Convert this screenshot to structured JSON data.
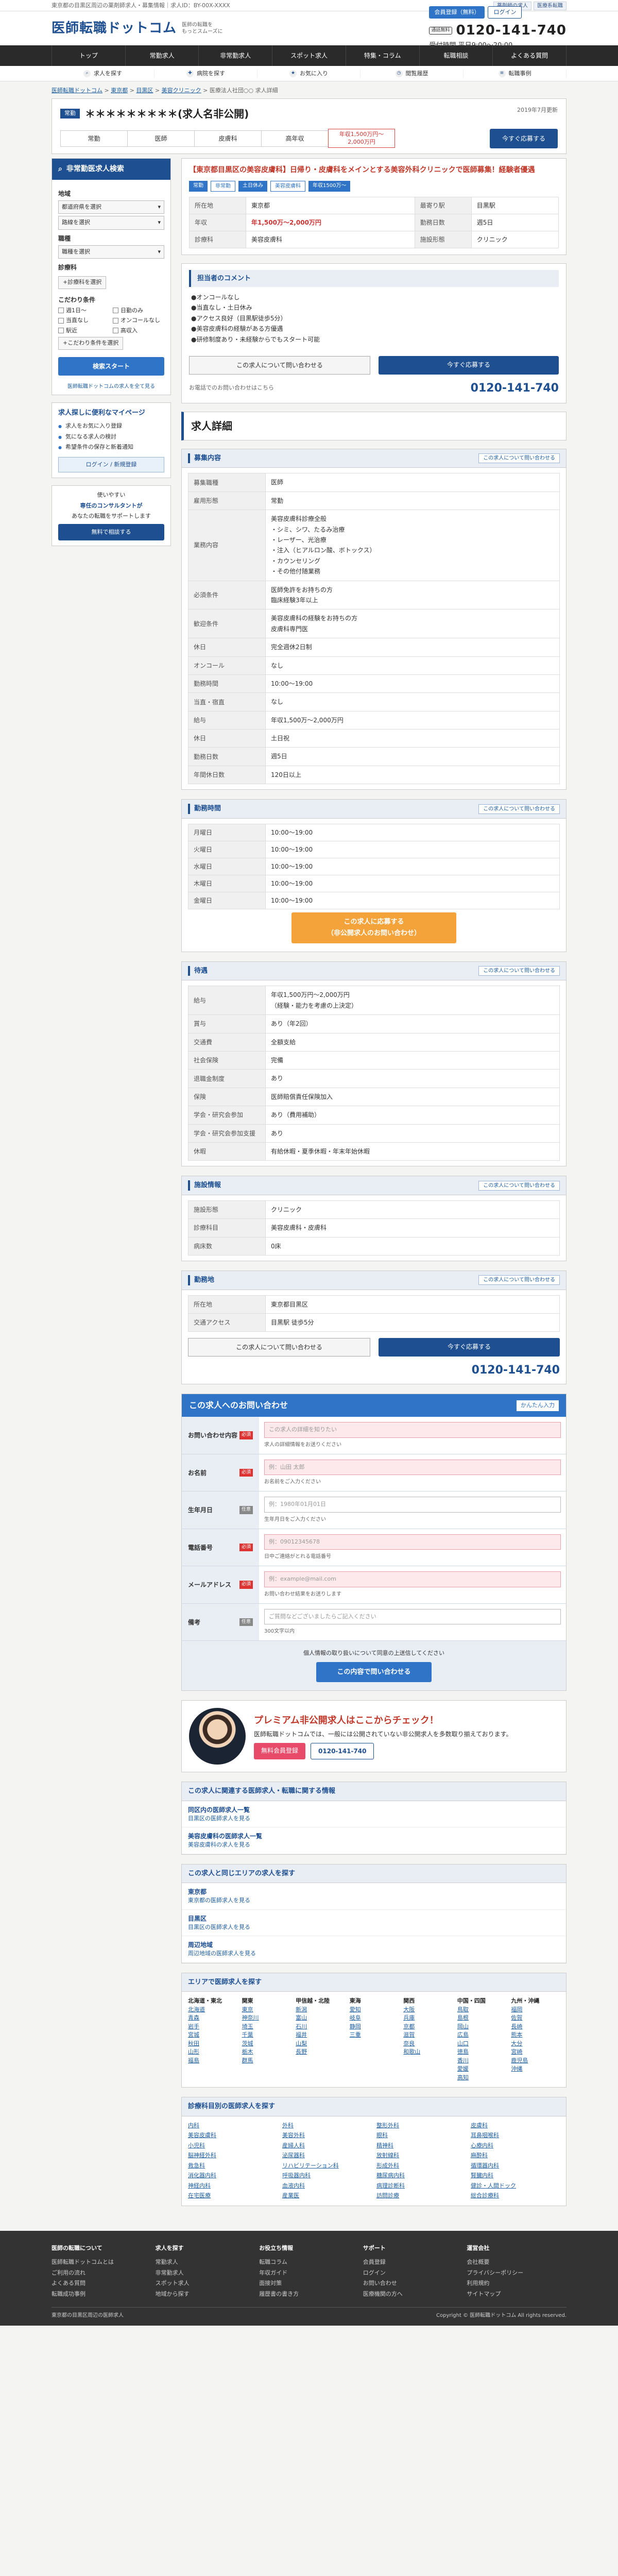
{
  "topbar": {
    "text": "東京都の目黒区周辺の薬剤師求人・募集情報｜求人ID：BY-00X-XXXX",
    "links": [
      "薬剤師の求人",
      "医療系転職"
    ]
  },
  "header": {
    "logo": "医師転職ドットコム",
    "sub_line1": "医師の転職を",
    "sub_line2": "もっとスムーズに",
    "register": "会員登録（無料）",
    "login": "ログイン",
    "tel_free": "通話無料",
    "tel": "0120-141-740",
    "hours": "受付時間 平日9:00〜20:00"
  },
  "nav": [
    "トップ",
    "常勤求人",
    "非常勤求人",
    "スポット求人",
    "特集・コラム",
    "転職相談",
    "よくある質問"
  ],
  "subnav": [
    "求人を探す",
    "病院を探す",
    "お気に入り",
    "閲覧履歴",
    "転職事例"
  ],
  "crumbs": [
    "医師転職ドットコム",
    "東京都",
    "目黒区",
    "美容クリニック",
    "医療法人社団○○ 求人詳細"
  ],
  "title": {
    "tag": "常勤",
    "name": "＊＊＊＊＊＊＊＊＊(求人名非公開)",
    "date": "2019年7月更新",
    "cells": [
      "常勤",
      "医師",
      "皮膚科",
      "高年収"
    ],
    "highlight": "年収1,500万円〜\n2,000万円",
    "cta": "今すぐ応募する"
  },
  "side": {
    "head": "非常勤医求人検索",
    "area_label": "地域",
    "area_sel": "都道府県を選択",
    "line_sel": "路線を選択",
    "job_label": "職種",
    "job_sel": "職種を選択",
    "spec_label": "診療科",
    "spec_sel": "+診療科を選択",
    "cond_label": "こだわり条件",
    "conds": [
      "週1日〜",
      "日勤のみ",
      "当直なし",
      "オンコールなし",
      "駅近",
      "高収入"
    ],
    "more": "+こだわり条件を選択",
    "search": "検索スタート",
    "foot": "医師転職ドットコムの求人を全て見る",
    "reg_title": "求人探しに便利なマイページ",
    "reg_items": [
      "求人をお気に入り登録",
      "気になる求人の検討",
      "希望条件の保存と新着通知"
    ],
    "reg_btn": "ログイン / 新規登録",
    "ban_1": "使いやすい",
    "ban_2": "専任のコンサルタントが",
    "ban_3": "あなたの転職をサポートします",
    "ban_btn": "無料で相談する"
  },
  "card": {
    "lead": "【東京都目黒区の美容皮膚科】日帰り・皮膚科をメインとする美容外科クリニックで医師募集！経験者優遇",
    "tags": [
      "常勤",
      "非常勤",
      "土日休み",
      "美容皮膚科",
      "年収1500万〜"
    ],
    "rows": [
      [
        "所在地",
        "東京都",
        "最寄り駅",
        "目黒駅"
      ],
      [
        "年収",
        "年1,500万〜2,000万円",
        "勤務日数",
        "週5日"
      ],
      [
        "診療科",
        "美容皮膚科",
        "施設形態",
        "クリニック"
      ]
    ]
  },
  "features": {
    "head": "担当者のコメント",
    "text": "●オンコールなし\n●当直なし・土日休み\n●アクセス良好（目黒駅徒歩5分）\n●美容皮膚科の経験がある方優遇\n●研修制度あり・未経験からでもスタート可能",
    "cta1": "この求人について問い合わせる",
    "cta2": "今すぐ応募する",
    "tel_lbl": "お電話でのお問い合わせはこちら",
    "tel": "0120-141-740"
  },
  "detail_head": "求人詳細",
  "d1": {
    "head": "募集内容",
    "more": "この求人について問い合わせる",
    "rows": [
      [
        "募集職種",
        "医師"
      ],
      [
        "雇用形態",
        "常勤"
      ],
      [
        "業務内容",
        "美容皮膚科診療全般\n・シミ、シワ、たるみ治療\n・レーザー、光治療\n・注入（ヒアルロン酸、ボトックス）\n・カウンセリング\n・その他付随業務"
      ],
      [
        "必須条件",
        "医師免許をお持ちの方\n臨床経験3年以上"
      ],
      [
        "歓迎条件",
        "美容皮膚科の経験をお持ちの方\n皮膚科専門医"
      ],
      [
        "休日",
        "完全週休2日制"
      ],
      [
        "オンコール",
        "なし"
      ],
      [
        "勤務時間",
        "10:00〜19:00"
      ],
      [
        "当直・宿直",
        "なし"
      ],
      [
        "給与",
        "年収1,500万〜2,000万円"
      ],
      [
        "休日",
        "土日祝"
      ],
      [
        "勤務日数",
        "週5日"
      ],
      [
        "年間休日数",
        "120日以上"
      ]
    ]
  },
  "d2": {
    "head": "勤務時間",
    "more": "この求人について問い合わせる",
    "rows": [
      [
        "月曜日",
        "10:00〜19:00"
      ],
      [
        "火曜日",
        "10:00〜19:00"
      ],
      [
        "水曜日",
        "10:00〜19:00"
      ],
      [
        "木曜日",
        "10:00〜19:00"
      ],
      [
        "金曜日",
        "10:00〜19:00"
      ]
    ],
    "apply": "この求人に応募する\n（非公開求人のお問い合わせ）"
  },
  "d3": {
    "head": "待遇",
    "more": "この求人について問い合わせる",
    "rows": [
      [
        "給与",
        "年収1,500万円〜2,000万円\n（経験・能力を考慮の上決定）"
      ],
      [
        "賞与",
        "あり（年2回）"
      ],
      [
        "交通費",
        "全額支給"
      ],
      [
        "社会保険",
        "完備"
      ],
      [
        "退職金制度",
        "あり"
      ],
      [
        "保険",
        "医師賠償責任保険加入"
      ],
      [
        "学会・研究会参加",
        "あり（費用補助）"
      ],
      [
        "学会・研究会参加支援",
        "あり"
      ],
      [
        "休暇",
        "有給休暇・夏季休暇・年末年始休暇"
      ]
    ]
  },
  "d4": {
    "head": "施設情報",
    "more": "この求人について問い合わせる",
    "rows": [
      [
        "施設形態",
        "クリニック"
      ],
      [
        "診療科目",
        "美容皮膚科・皮膚科"
      ],
      [
        "病床数",
        "0床"
      ]
    ]
  },
  "d5": {
    "head": "勤務地",
    "more": "この求人について問い合わせる",
    "rows": [
      [
        "所在地",
        "東京都目黒区"
      ],
      [
        "交通アクセス",
        "目黒駅 徒歩5分"
      ]
    ],
    "cta1": "この求人について問い合わせる",
    "cta2": "今すぐ応募する",
    "tel": "0120-141-740"
  },
  "form": {
    "head": "この求人へのお問い合わせ",
    "head_note": "かんたん入力",
    "rows": [
      [
        "お問い合わせ内容",
        "必須",
        "この求人の詳細を知りたい",
        "求人の詳細情報をお送りください"
      ],
      [
        "お名前",
        "必須",
        "例：山田 太郎",
        "お名前をご入力ください"
      ],
      [
        "生年月日",
        "任意",
        "例：1980年01月01日",
        "生年月日をご入力ください"
      ],
      [
        "電話番号",
        "必須",
        "例：09012345678",
        "日中ご連絡がとれる電話番号"
      ],
      [
        "メールアドレス",
        "必須",
        "例：example@mail.com",
        "お問い合わせ結果をお送りします"
      ],
      [
        "備考",
        "任意",
        "ご質問などございましたらご記入ください",
        "300文字以内"
      ]
    ],
    "note": "個人情報の取り扱いについて同意の上送信してください",
    "submit": "この内容で問い合わせる"
  },
  "promo": {
    "h": "プレミアム非公開求人はここからチェック！",
    "text": "医師転職ドットコムでは、一般には公開されていない非公開求人を多数取り揃えております。",
    "b1": "無料会員登録",
    "b2": "0120-141-740"
  },
  "rel1": {
    "head": "この求人に関連する医師求人・転職に関する情報",
    "items": [
      [
        "同区内の医師求人一覧",
        "目黒区の医師求人を見る"
      ],
      [
        "美容皮膚科の医師求人一覧",
        "美容皮膚科の求人を見る"
      ]
    ]
  },
  "rel2": {
    "head": "この求人と同じエリアの求人を探す",
    "items": [
      [
        "東京都",
        "東京都の医師求人を見る"
      ],
      [
        "目黒区",
        "目黒区の医師求人を見る"
      ],
      [
        "周辺地域",
        "周辺地域の医師求人を見る"
      ]
    ]
  },
  "areas": {
    "head": "エリアで医師求人を探す",
    "cols": [
      [
        "北海道・東北",
        "北海道",
        "青森",
        "岩手",
        "宮城",
        "秋田",
        "山形",
        "福島"
      ],
      [
        "関東",
        "東京",
        "神奈川",
        "埼玉",
        "千葉",
        "茨城",
        "栃木",
        "群馬"
      ],
      [
        "甲信越・北陸",
        "新潟",
        "富山",
        "石川",
        "福井",
        "山梨",
        "長野"
      ],
      [
        "東海",
        "愛知",
        "岐阜",
        "静岡",
        "三重"
      ],
      [
        "関西",
        "大阪",
        "兵庫",
        "京都",
        "滋賀",
        "奈良",
        "和歌山"
      ],
      [
        "中国・四国",
        "鳥取",
        "島根",
        "岡山",
        "広島",
        "山口",
        "徳島",
        "香川",
        "愛媛",
        "高知"
      ],
      [
        "九州・沖縄",
        "福岡",
        "佐賀",
        "長崎",
        "熊本",
        "大分",
        "宮崎",
        "鹿児島",
        "沖縄"
      ]
    ]
  },
  "specs": {
    "head": "診療科目別の医師求人を探す",
    "items": [
      "内科",
      "外科",
      "整形外科",
      "皮膚科",
      "美容皮膚科",
      "美容外科",
      "眼科",
      "耳鼻咽喉科",
      "小児科",
      "産婦人科",
      "精神科",
      "心療内科",
      "脳神経外科",
      "泌尿器科",
      "放射線科",
      "麻酔科",
      "救急科",
      "リハビリテーション科",
      "形成外科",
      "循環器内科",
      "消化器内科",
      "呼吸器内科",
      "糖尿病内科",
      "腎臓内科",
      "神経内科",
      "血液内科",
      "病理診断科",
      "健診・人間ドック",
      "在宅医療",
      "産業医",
      "訪問診療",
      "総合診療科"
    ]
  },
  "footer": {
    "cols": [
      [
        "医師の転職について",
        "医師転職ドットコムとは",
        "ご利用の流れ",
        "よくある質問",
        "転職成功事例"
      ],
      [
        "求人を探す",
        "常勤求人",
        "非常勤求人",
        "スポット求人",
        "地域から探す"
      ],
      [
        "お役立ち情報",
        "転職コラム",
        "年収ガイド",
        "面接対策",
        "履歴書の書き方"
      ],
      [
        "サポート",
        "会員登録",
        "ログイン",
        "お問い合わせ",
        "医療機関の方へ"
      ],
      [
        "運営会社",
        "会社概要",
        "プライバシーポリシー",
        "利用規約",
        "サイトマップ"
      ]
    ],
    "copy": "Copyright © 医師転職ドットコム All rights reserved.",
    "bot_left": "東京都の目黒区周辺の医師求人"
  }
}
